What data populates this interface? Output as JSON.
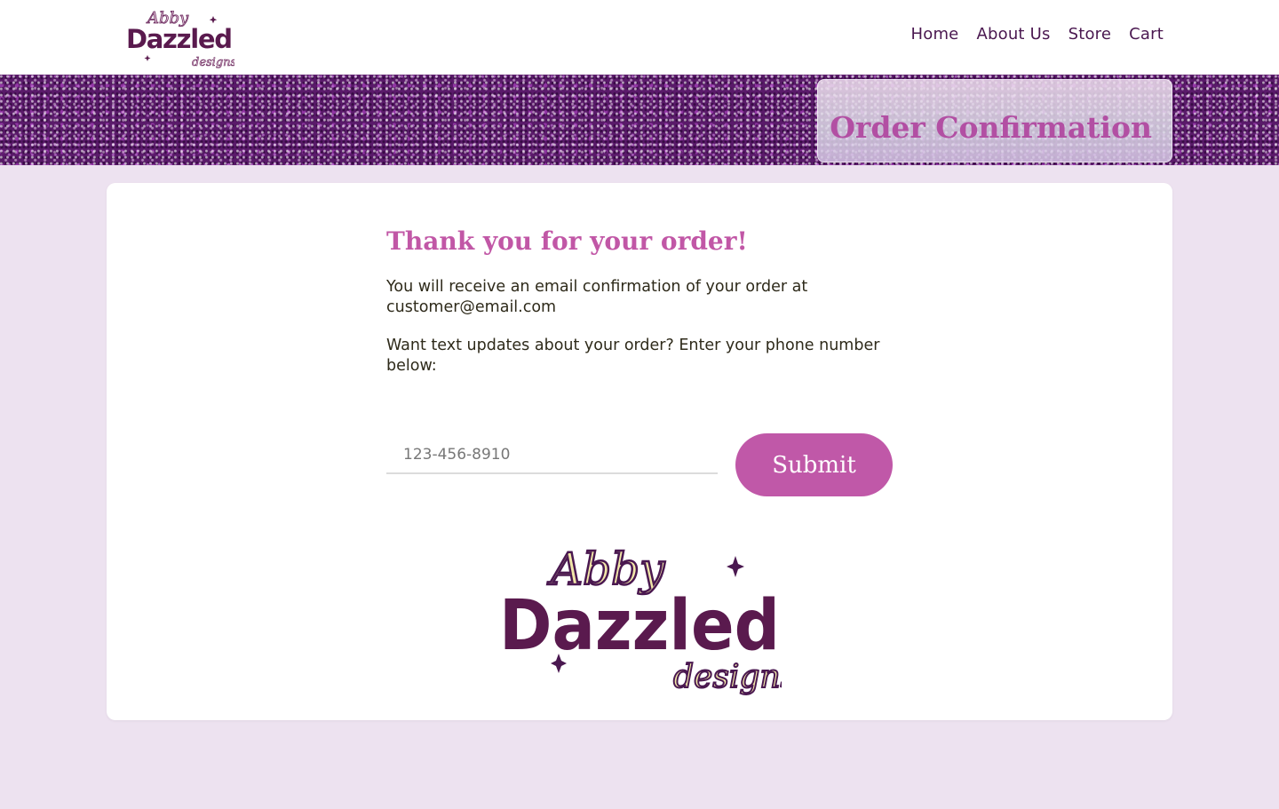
{
  "header": {
    "logo": {
      "line1": "Abby",
      "line2": "Dazzled",
      "line3": "designs"
    },
    "nav": [
      {
        "label": "Home"
      },
      {
        "label": "About Us"
      },
      {
        "label": "Store"
      },
      {
        "label": "Cart"
      }
    ]
  },
  "banner": {
    "title": "Order Confirmation"
  },
  "main": {
    "heading": "Thank you for your order!",
    "email_message": "You will receive an email confirmation of your order at customer@email.com",
    "text_prompt": "Want text updates about your order? Enter your phone number below:",
    "phone_placeholder": "123-456-8910",
    "phone_value": "",
    "submit_label": "Submit"
  },
  "footer_logo": {
    "line1": "Abby",
    "line2": "Dazzled",
    "line3": "designs"
  },
  "colors": {
    "page_bg": "#ede2f0",
    "accent": "#c058a8",
    "nav_text": "#4a1850",
    "logo_purple": "#5a1a4e"
  }
}
